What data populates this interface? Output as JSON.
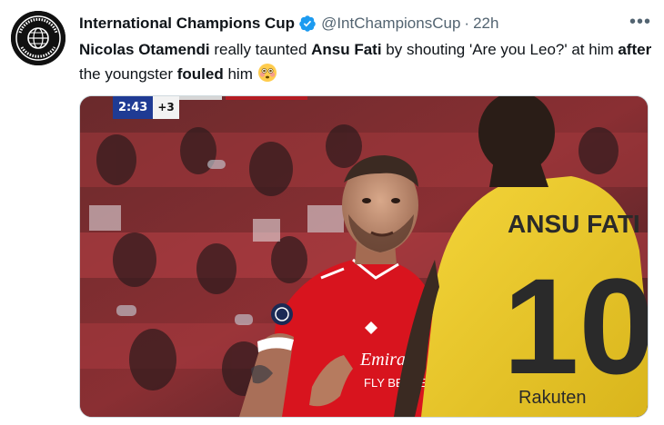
{
  "tweet": {
    "author_name": "International Champions Cup",
    "author_handle": "@IntChampionsCup",
    "separator": "·",
    "timestamp": "22h",
    "more_label": "•••",
    "text_segments": [
      {
        "t": "Nicolas Otamendi",
        "bold": true
      },
      {
        "t": " really taunted ",
        "bold": false
      },
      {
        "t": "Ansu Fati",
        "bold": true
      },
      {
        "t": " by shouting 'Are you Leo?' at him ",
        "bold": false
      },
      {
        "t": "after",
        "bold": true
      },
      {
        "t": " the youngster ",
        "bold": false
      },
      {
        "t": "fouled",
        "bold": true
      },
      {
        "t": " him ",
        "bold": false
      }
    ],
    "emoji": "flushed-face"
  },
  "media": {
    "scorebug_clock": "2:43",
    "scorebug_added": "+3",
    "shirt_name_right": "ANSU FATI",
    "shirt_number_right": "10",
    "shirt_sponsor_right": "Rakuten",
    "shirt_sponsor_left": "Emirates",
    "shirt_sponsor_left_2": "FLY BETTER",
    "colors": {
      "benfica_red": "#d8141e",
      "barca_yellow": "#f1cf2a",
      "barca_text": "#2a2a2a"
    }
  },
  "brand": {
    "verified_color": "#1d9bf0"
  }
}
